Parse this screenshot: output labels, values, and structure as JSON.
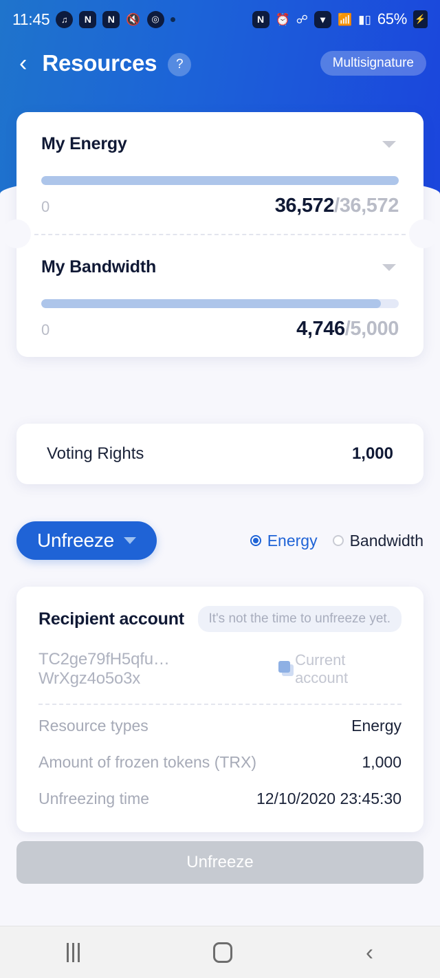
{
  "status_bar": {
    "time": "11:45",
    "left_icons": [
      "spotify-icon",
      "app-badge-n1",
      "app-badge-n2",
      "mute-icon",
      "pokeball-icon",
      "dot-icon"
    ],
    "badge_n1": "N",
    "badge_n2": "N",
    "right_icons": [
      "nfc-icon",
      "alarm-icon",
      "bluetooth-icon",
      "data-saver-icon",
      "wifi-icon",
      "signal-icon"
    ],
    "nfc_label": "N",
    "battery_percent": "65%",
    "battery_glyph": "⚡"
  },
  "header": {
    "back_icon": "‹",
    "title": "Resources",
    "help_label": "?",
    "multisignature_label": "Multisignature"
  },
  "resources": {
    "energy": {
      "title": "My Energy",
      "min": "0",
      "current": "36,572",
      "separator": "/",
      "max": "36,572",
      "percent": 100
    },
    "bandwidth": {
      "title": "My Bandwidth",
      "min": "0",
      "current": "4,746",
      "separator": "/",
      "max": "5,000",
      "percent": 95
    }
  },
  "voting": {
    "label": "Voting Rights",
    "value": "1,000"
  },
  "action": {
    "button_label": "Unfreeze",
    "options": [
      {
        "label": "Energy",
        "selected": true
      },
      {
        "label": "Bandwidth",
        "selected": false
      }
    ]
  },
  "recipient": {
    "title": "Recipient account",
    "badge": "It's not the time to unfreeze yet.",
    "address": "TC2ge79fH5qfu…WrXgz4o5o3x",
    "account_note": "Current account",
    "details": [
      {
        "label": "Resource types",
        "value": "Energy"
      },
      {
        "label": "Amount of frozen tokens (TRX)",
        "value": "1,000"
      },
      {
        "label": "Unfreezing time",
        "value": "12/10/2020 23:45:30"
      }
    ]
  },
  "bottom_action": {
    "label": "Unfreeze",
    "enabled": false
  },
  "system_nav": {
    "recents_icon": "recents-icon",
    "home_icon": "home-icon",
    "back_icon": "‹"
  },
  "colors": {
    "header_gradient_start": "#1f74cc",
    "header_gradient_end": "#1b45dd",
    "accent_blue": "#1f63d6",
    "progress_fill": "#adc5ea",
    "progress_track": "#e4e9f7",
    "page_background": "#f7f7fc",
    "disabled_button": "#c6cad1"
  }
}
